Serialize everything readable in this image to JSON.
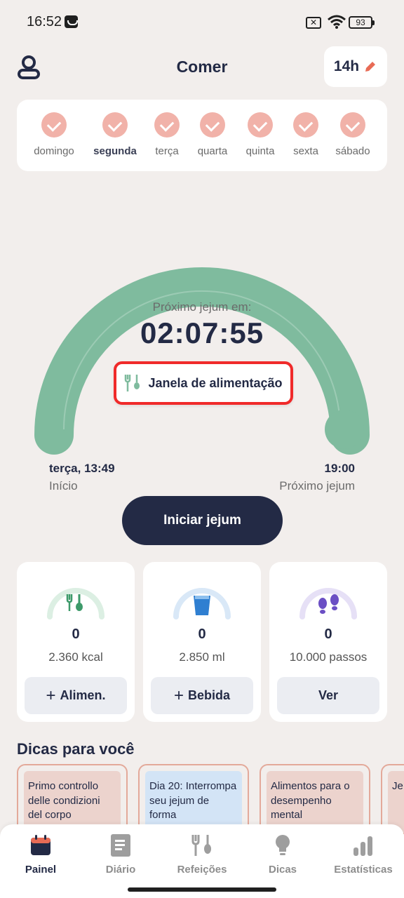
{
  "status_bar": {
    "time": "16:52",
    "battery": "93",
    "sim_icon": "sim-off-icon",
    "wifi_icon": "wifi-icon"
  },
  "header": {
    "title": "Comer",
    "fast_hours": "14h"
  },
  "week": {
    "days": [
      {
        "label": "domingo",
        "bold": false
      },
      {
        "label": "segunda",
        "bold": true
      },
      {
        "label": "terça",
        "bold": false
      },
      {
        "label": "quarta",
        "bold": false
      },
      {
        "label": "quinta",
        "bold": false
      },
      {
        "label": "sexta",
        "bold": false
      },
      {
        "label": "sábado",
        "bold": false
      }
    ]
  },
  "gauge": {
    "next_label": "Próximo jejum em:",
    "timer": "02:07:55",
    "window_label": "Janela de alimentação",
    "start_time": "terça, 13:49",
    "start_label": "Início",
    "end_time": "19:00",
    "end_label": "Próximo jejum"
  },
  "start_button": "Iniciar jejum",
  "stats": [
    {
      "value": "0",
      "goal": "2.360 kcal",
      "button": "Alimen.",
      "plus": "+",
      "icon": "cutlery-icon"
    },
    {
      "value": "0",
      "goal": "2.850 ml",
      "button": "Bebida",
      "plus": "+",
      "icon": "water-glass-icon"
    },
    {
      "value": "0",
      "goal": "10.000 passos",
      "button": "Ver",
      "plus": "",
      "icon": "footsteps-icon"
    }
  ],
  "tips": {
    "title": "Dicas para você",
    "cards": [
      {
        "text": "Primo controllo delle condizioni del corpo"
      },
      {
        "text": "Dia 20: Interrompa seu jejum de forma"
      },
      {
        "text": "Alimentos para o desempenho mental"
      },
      {
        "text": "Je dia"
      }
    ]
  },
  "nav": {
    "items": [
      {
        "label": "Painel",
        "icon": "calendar-icon"
      },
      {
        "label": "Diário",
        "icon": "diary-icon"
      },
      {
        "label": "Refeições",
        "icon": "meals-icon"
      },
      {
        "label": "Dicas",
        "icon": "lightbulb-icon"
      },
      {
        "label": "Estatísticas",
        "icon": "stats-icon"
      }
    ]
  },
  "colors": {
    "accent": "#232a45",
    "gauge": "#7fbb9e",
    "check": "#f1b2a9",
    "highlight": "#f02a2a"
  }
}
